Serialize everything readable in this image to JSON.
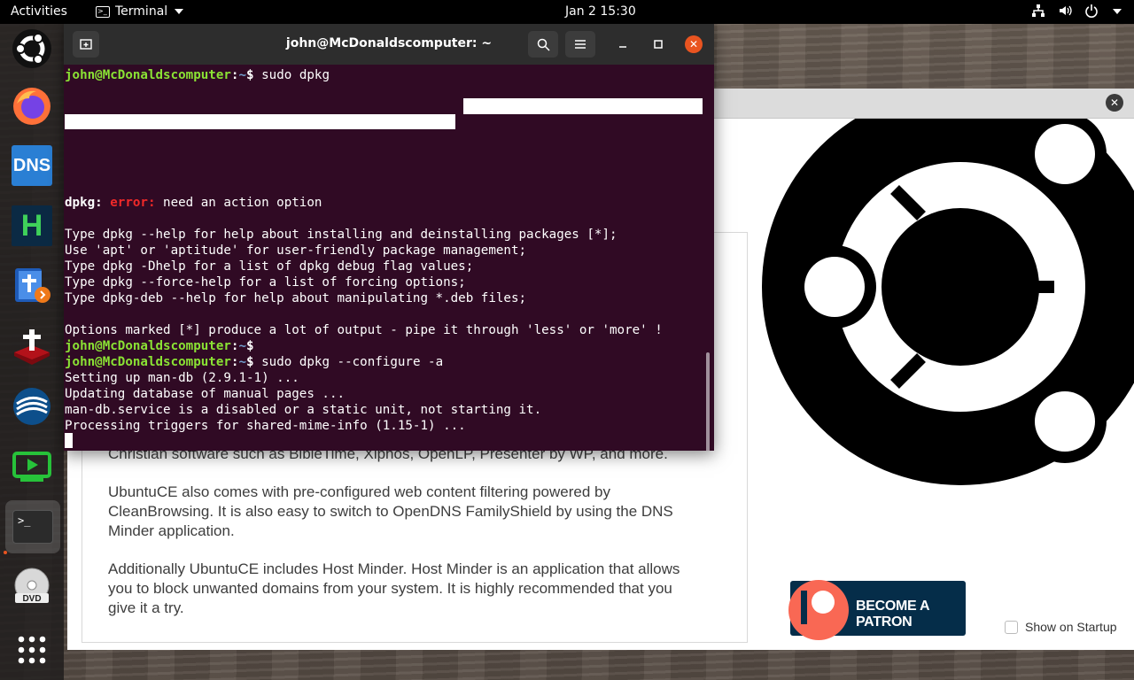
{
  "topbar": {
    "activities": "Activities",
    "app_name": "Terminal",
    "clock": "Jan 2  15:30"
  },
  "dock": {
    "items": [
      {
        "name": "ubuntu-icon"
      },
      {
        "name": "firefox-icon"
      },
      {
        "name": "dns-minder-icon",
        "label": "DNS"
      },
      {
        "name": "host-minder-icon",
        "label": "H"
      },
      {
        "name": "bible-app-icon"
      },
      {
        "name": "bibletime-icon"
      },
      {
        "name": "openlp-icon"
      },
      {
        "name": "presenter-icon"
      },
      {
        "name": "terminal-icon",
        "label": ">_"
      },
      {
        "name": "dvd-icon",
        "label": "DVD"
      },
      {
        "name": "show-apps-icon"
      }
    ]
  },
  "terminal": {
    "title": "john@McDonaldscomputer: ~",
    "prompt_user": "john@McDonaldscomputer",
    "prompt_path": "~",
    "cmd1": "sudo dpkg",
    "err_prefix": "dpkg: ",
    "err_word": "error:",
    "err_msg": " need an action option",
    "help_lines": [
      "Type dpkg --help for help about installing and deinstalling packages [*];",
      "Use 'apt' or 'aptitude' for user-friendly package management;",
      "Type dpkg -Dhelp for a list of dpkg debug flag values;",
      "Type dpkg --force-help for a list of forcing options;",
      "Type dpkg-deb --help for help about manipulating *.deb files;"
    ],
    "options_line": "Options marked [*] produce a lot of output - pipe it through 'less' or 'more' !",
    "cmd2": "sudo dpkg --configure -a",
    "output_lines": [
      "Setting up man-db (2.9.1-1) ...",
      "Updating database of manual pages ...",
      "man-db.service is a disabled or a static unit, not starting it.",
      "Processing triggers for shared-mime-info (1.15-1) ..."
    ]
  },
  "welcome": {
    "para1": "Christian software such as BibleTime, Xiphos, OpenLP, Presenter by WP, and more.",
    "para2": "UbuntuCE also comes with pre-configured web content filtering powered by CleanBrowsing. It is also easy to switch to OpenDNS FamilyShield by using the DNS Minder application.",
    "para3": "Additionally UbuntuCE includes Host Minder. Host Minder is an application that allows you to block unwanted domains from your system. It is highly recommended that you give it a try.",
    "patron_label": "BECOME A PATRON",
    "show_on_startup": "Show on Startup"
  }
}
